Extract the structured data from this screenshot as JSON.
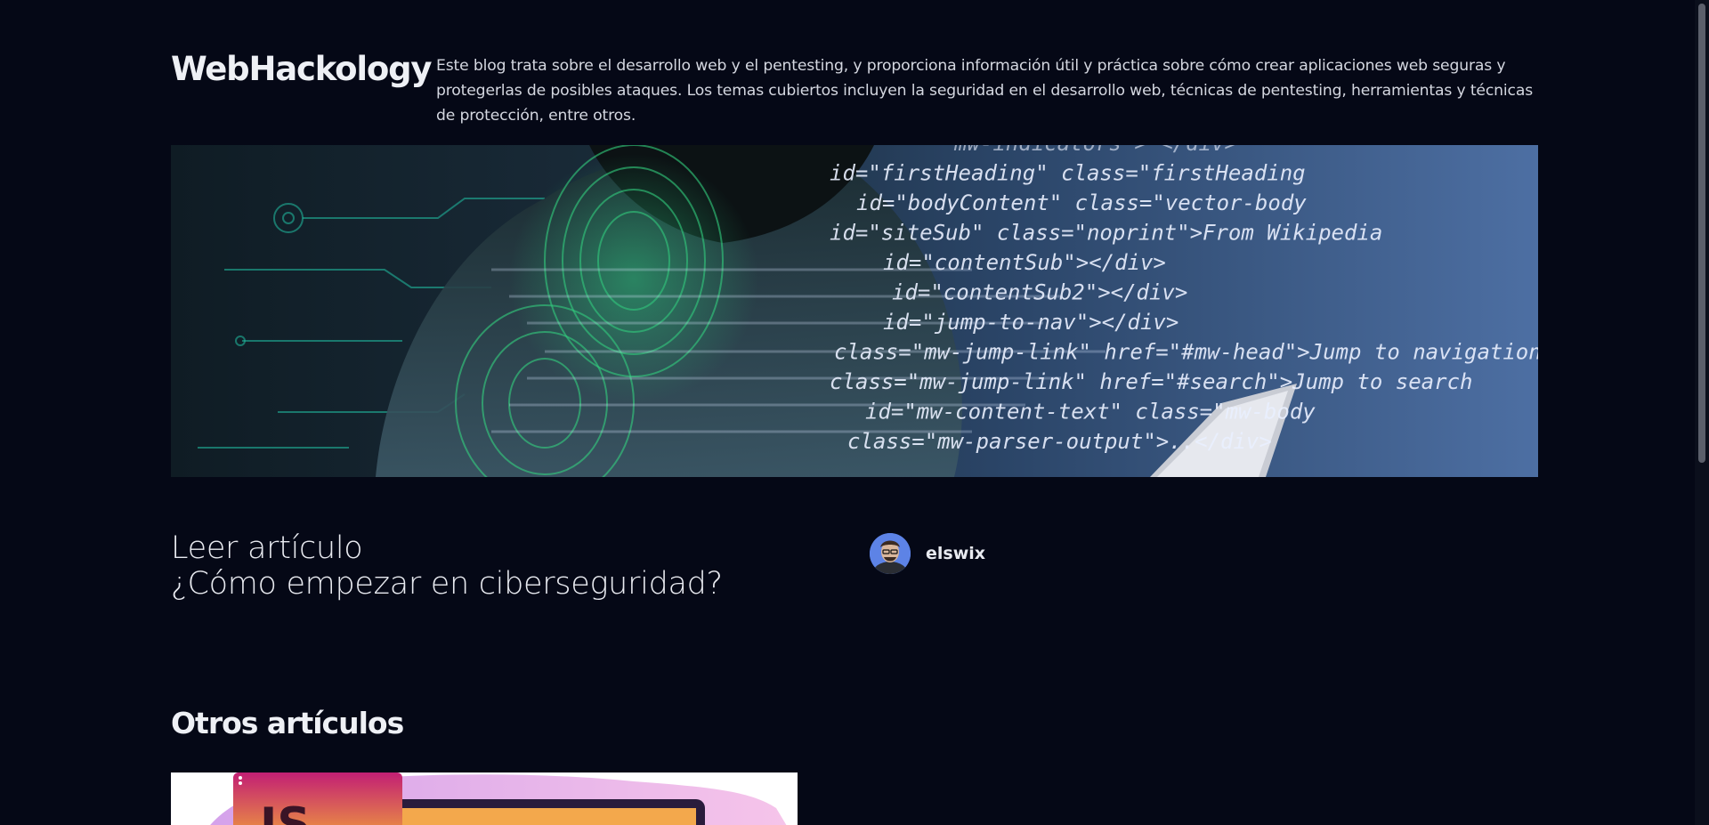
{
  "site": {
    "title": "WebHackology",
    "description": "Este blog trata sobre el desarrollo web y el pentesting, y proporciona información útil y práctica sobre cómo crear aplicaciones web seguras y protegerlas de posibles ataques. Los temas cubiertos incluyen la seguridad en el desarrollo web, técnicas de pentesting, herramientas y técnicas de protección, entre otros."
  },
  "hero": {
    "code_lines": [
      "mw-indicators\"> </div>",
      "id=\"firstHeading\" class=\"firstHeading",
      "id=\"bodyContent\" class=\"vector-body",
      "id=\"siteSub\" class=\"noprint\">From Wikipedia",
      "id=\"contentSub\"></div>",
      "id=\"contentSub2\"></div>",
      "id=\"jump-to-nav\"></div>",
      "class=\"mw-jump-link\" href=\"#mw-head\">Jump to navigation",
      "class=\"mw-jump-link\" href=\"#search\">Jump to search",
      "id=\"mw-content-text\" class=\"mw-body",
      "class=\"mw-parser-output\">..</div>"
    ]
  },
  "featured": {
    "link_label": "Leer artículo",
    "title": "¿Cómo empezar en ciberseguridad?",
    "author": "elswix"
  },
  "others": {
    "title": "Otros artículos"
  },
  "colors": {
    "background": "#050816",
    "text": "#e8eaf0",
    "code_text": "#eaf0ff"
  }
}
